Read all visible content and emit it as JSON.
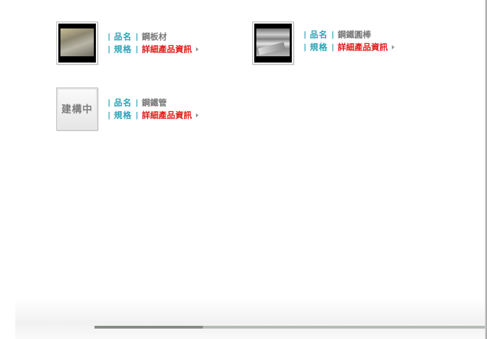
{
  "labels": {
    "name_label": "品名",
    "spec_label": "規格",
    "separator": "|"
  },
  "products": [
    {
      "name": "鋼板材",
      "detail_link": "詳細產品資訊",
      "thumbnail": "steel-plate-photo"
    },
    {
      "name": "鋼鐵圓棒",
      "detail_link": "詳細產品資訊",
      "thumbnail": "steel-bar-photo"
    },
    {
      "name": "鋼鐵管",
      "detail_link": "詳細產品資訊",
      "thumbnail_text": "建構中"
    }
  ],
  "colors": {
    "label": "#2aa3b5",
    "name": "#7a7a7a",
    "link": "#e31b1b"
  },
  "icons": {
    "link_arrow": "arrow-right-icon"
  }
}
